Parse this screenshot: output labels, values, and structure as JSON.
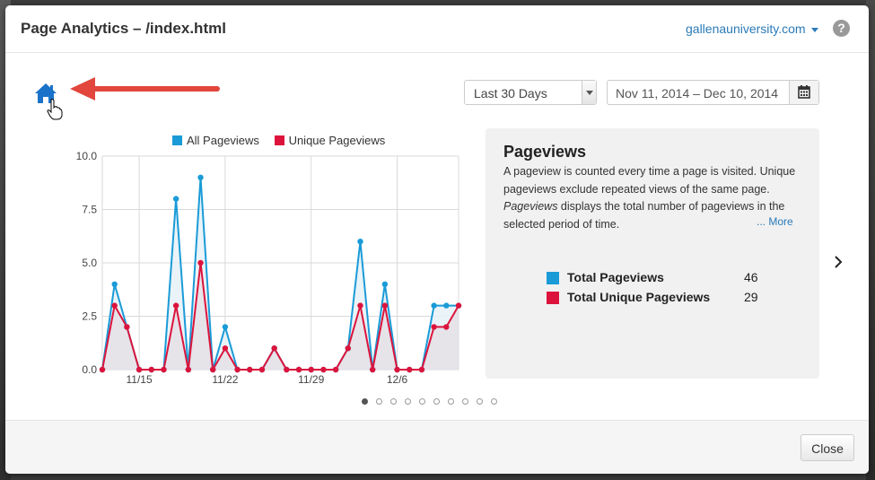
{
  "modal": {
    "title": "Page Analytics – /index.html",
    "site": "gallenauniversity.com",
    "help_label": "?"
  },
  "controls": {
    "range": "Last 30 Days",
    "dates": "Nov 11, 2014 – Dec 10, 2014"
  },
  "icons": {
    "home": "home-icon",
    "cursor": "hand-cursor-icon",
    "arrow": "red-arrow-icon",
    "calendar": "calendar-icon",
    "next": "chevron-right-icon"
  },
  "colors": {
    "all_pageviews": "#1a9bd7",
    "unique_pageviews": "#dc143c",
    "arrow": "#e2463c",
    "link": "#2a7ab8"
  },
  "info": {
    "title": "Pageviews",
    "desc_1": "A pageview is counted every time a page is visited. Unique pageviews exclude repeated views of the same page. ",
    "desc_em": "Pageviews",
    "desc_2": " displays the total number of pageviews in the selected period of time.",
    "more": "... More",
    "totals": [
      {
        "label": "Total Pageviews",
        "value": "46"
      },
      {
        "label": "Total Unique Pageviews",
        "value": "29"
      }
    ]
  },
  "pager": {
    "count": 10,
    "active": 0
  },
  "footer": {
    "close": "Close"
  },
  "chart_data": {
    "type": "line",
    "legend": [
      "All Pageviews",
      "Unique Pageviews"
    ],
    "ylim": [
      0,
      10
    ],
    "yticks": [
      "10.0",
      "7.5",
      "5.0",
      "2.5",
      "0.0"
    ],
    "xtick_labels": [
      "11/15",
      "11/22",
      "11/29",
      "12/6"
    ],
    "xtick_index": [
      3,
      10,
      17,
      24
    ],
    "grid": true,
    "series": [
      {
        "name": "All Pageviews",
        "values": [
          0,
          4,
          2,
          0,
          0,
          0,
          8,
          0,
          9,
          0,
          2,
          0,
          0,
          0,
          1,
          0,
          0,
          0,
          0,
          0,
          1,
          6,
          0,
          4,
          0,
          0,
          0,
          3,
          3,
          3
        ]
      },
      {
        "name": "Unique Pageviews",
        "values": [
          0,
          3,
          2,
          0,
          0,
          0,
          3,
          0,
          5,
          0,
          1,
          0,
          0,
          0,
          1,
          0,
          0,
          0,
          0,
          0,
          1,
          3,
          0,
          3,
          0,
          0,
          0,
          2,
          2,
          3
        ]
      }
    ]
  }
}
